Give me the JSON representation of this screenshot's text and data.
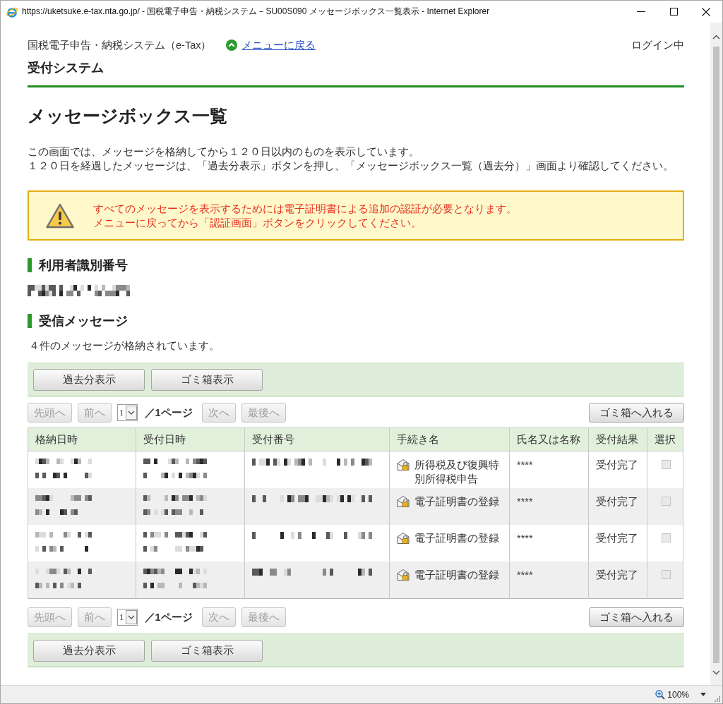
{
  "window": {
    "title": "https://uketsuke.e-tax.nta.go.jp/ - 国税電子申告・納税システム－SU00S090 メッセージボックス一覧表示 - Internet Explorer"
  },
  "header": {
    "system_name": "国税電子申告・納税システム（e-Tax）",
    "menu_link": "メニューに戻る",
    "login_status": "ログイン中",
    "subsystem": "受付システム"
  },
  "page_title": "メッセージボックス一覧",
  "description": [
    "この画面では、メッセージを格納してから１２０日以内のものを表示しています。",
    "１２０日を経過したメッセージは、「過去分表示」ボタンを押し、「メッセージボックス一覧（過去分）」画面より確認してください。"
  ],
  "alert": {
    "lines": [
      "すべてのメッセージを表示するためには電子証明書による追加の認証が必要となります。",
      "メニューに戻ってから「認証画面」ボタンをクリックしてください。"
    ]
  },
  "user_id_section": {
    "heading": "利用者識別番号"
  },
  "messages_section": {
    "heading": "受信メッセージ",
    "count_text": "４件のメッセージが格納されています。"
  },
  "toolbar_top": {
    "buttons": [
      "過去分表示",
      "ゴミ箱表示"
    ]
  },
  "pagination_top": {
    "first": {
      "label": "先頭へ",
      "disabled": true
    },
    "prev": {
      "label": "前へ",
      "disabled": true
    },
    "page_select": "1",
    "page_total": "／1ページ",
    "next": {
      "label": "次へ",
      "disabled": true
    },
    "last": {
      "label": "最後へ",
      "disabled": true
    },
    "trash": {
      "label": "ゴミ箱へ入れる",
      "disabled": false
    }
  },
  "table": {
    "columns": [
      "格納日時",
      "受付日時",
      "受付番号",
      "手続き名",
      "氏名又は名称",
      "受付結果",
      "選択"
    ],
    "rows": [
      {
        "procedure": "所得税及び復興特別所得税申告",
        "name": "****",
        "result": "受付完了",
        "checked": false,
        "disabled": true
      },
      {
        "procedure": "電子証明書の登録",
        "name": "****",
        "result": "受付完了",
        "checked": false,
        "disabled": true
      },
      {
        "procedure": "電子証明書の登録",
        "name": "****",
        "result": "受付完了",
        "checked": false,
        "disabled": true
      },
      {
        "procedure": "電子証明書の登録",
        "name": "****",
        "result": "受付完了",
        "checked": false,
        "disabled": true
      }
    ]
  },
  "pagination_bottom": {
    "first": {
      "label": "先頭へ",
      "disabled": true
    },
    "prev": {
      "label": "前へ",
      "disabled": true
    },
    "page_select": "1",
    "page_total": "／1ページ",
    "next": {
      "label": "次へ",
      "disabled": true
    },
    "last": {
      "label": "最後へ",
      "disabled": true
    },
    "trash": {
      "label": "ゴミ箱へ入れる",
      "disabled": false
    }
  },
  "toolbar_bottom": {
    "buttons": [
      "過去分表示",
      "ゴミ箱表示"
    ]
  },
  "status_bar": {
    "zoom": "100%"
  }
}
